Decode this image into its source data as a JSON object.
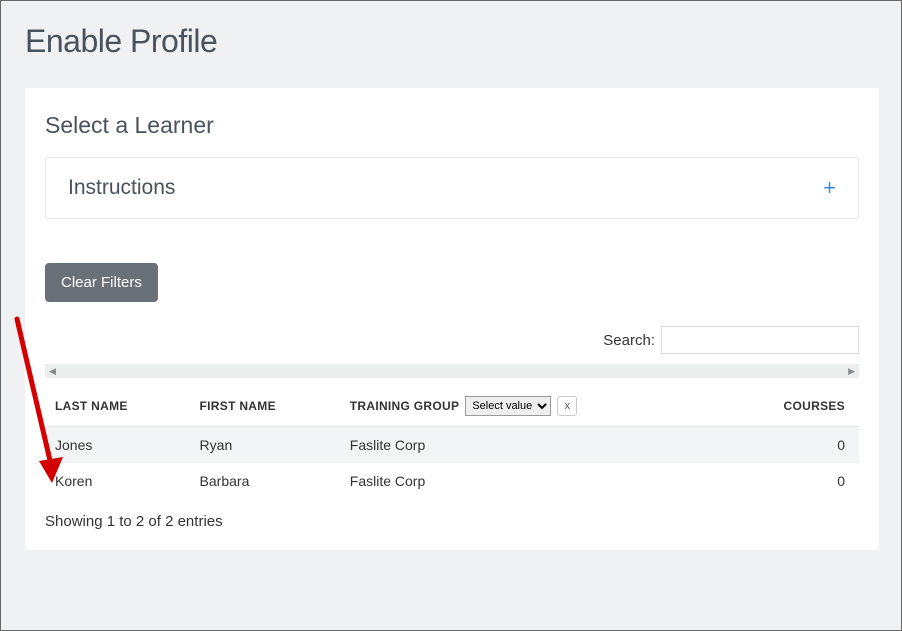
{
  "page": {
    "title": "Enable Profile"
  },
  "section": {
    "title": "Select a Learner"
  },
  "instructions": {
    "label": "Instructions",
    "expand_icon": "+"
  },
  "buttons": {
    "clear_filters": "Clear Filters"
  },
  "search": {
    "label": "Search:",
    "value": ""
  },
  "table": {
    "columns": {
      "last_name": "LAST NAME",
      "first_name": "FIRST NAME",
      "training_group": "TRAINING GROUP",
      "courses": "COURSES"
    },
    "training_group_filter": {
      "placeholder": "Select value",
      "clear_label": "x"
    },
    "rows": [
      {
        "last_name": "Jones",
        "first_name": "Ryan",
        "training_group": "Faslite Corp",
        "courses": "0"
      },
      {
        "last_name": "Koren",
        "first_name": "Barbara",
        "training_group": "Faslite Corp",
        "courses": "0"
      }
    ],
    "status": "Showing 1 to 2 of 2 entries"
  }
}
